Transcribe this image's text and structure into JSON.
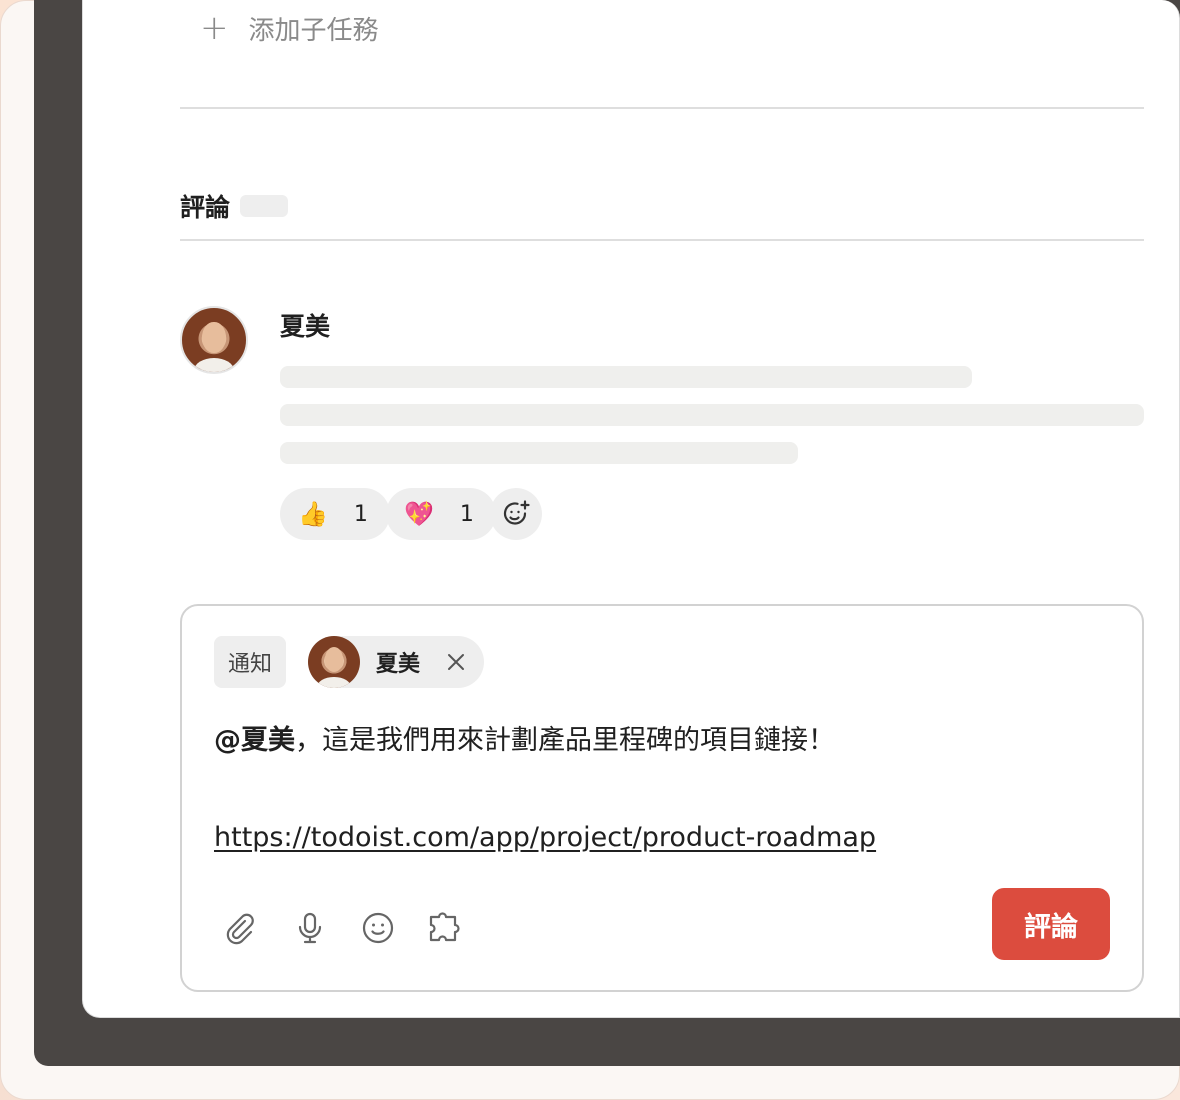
{
  "subtasks": {
    "add_label": "添加子任務"
  },
  "comments": {
    "title": "評論",
    "items": [
      {
        "author": "夏美",
        "reactions": [
          {
            "emoji": "👍",
            "count": "1"
          },
          {
            "emoji": "💖",
            "count": "1"
          }
        ]
      }
    ]
  },
  "composer": {
    "notify_label": "通知",
    "recipient_name": "夏美",
    "mention": "@夏美",
    "message": "，這是我們用來計劃產品里程碑的項目鏈接！",
    "link": "https://todoist.com/app/project/product-roadmap",
    "submit_label": "評論",
    "tool_icons": [
      "paperclip-icon",
      "microphone-icon",
      "emoji-icon",
      "extension-icon"
    ]
  },
  "colors": {
    "accent": "#dc4c3e",
    "dark_frame": "#4a4644"
  }
}
